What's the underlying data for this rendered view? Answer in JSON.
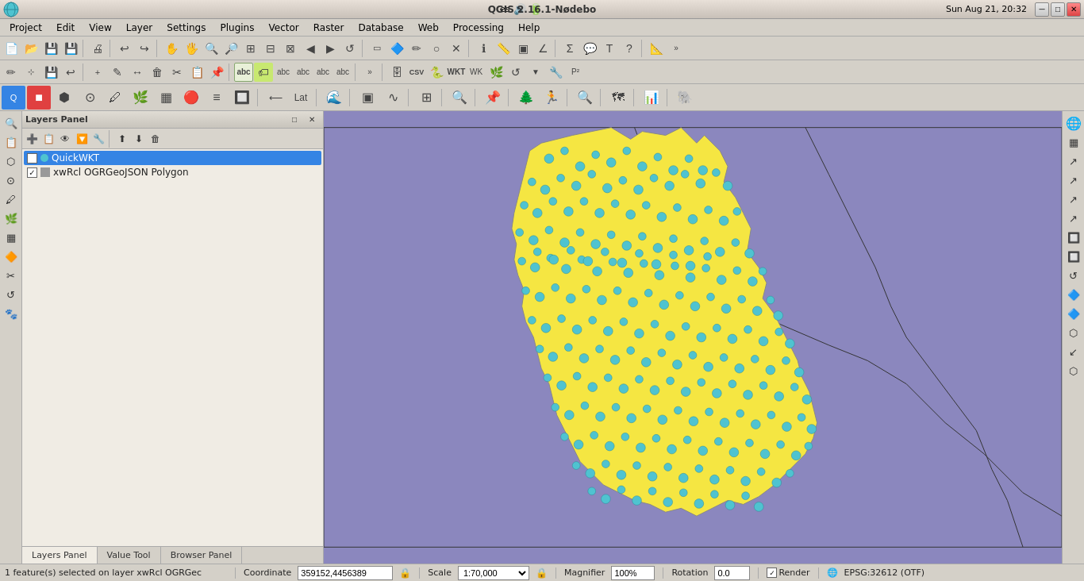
{
  "titlebar": {
    "app_icon": "🌍",
    "title": "QGIS 2.16.1-Nødebo",
    "sys_label": "es",
    "time": "Sun Aug 21, 20:32",
    "minimize": "─",
    "maximize": "□",
    "close": "✕"
  },
  "menubar": {
    "items": [
      "Project",
      "Edit",
      "View",
      "Layer",
      "Settings",
      "Plugins",
      "Vector",
      "Raster",
      "Database",
      "Web",
      "Processing",
      "Help"
    ]
  },
  "toolbar1": {
    "buttons": [
      "📄",
      "📂",
      "💾",
      "🖨",
      "🔄",
      "🔍",
      "🔎",
      "🔎",
      "🔎",
      "🔎",
      "🔎",
      "✋",
      "🖐",
      "↔",
      "🔄",
      "⬡",
      "⬡",
      "📌",
      "🔷",
      "🔲",
      "⬡",
      "🔍",
      "🔍",
      "🔍",
      "🔍",
      "🔍",
      "🔍",
      "🔄",
      "❓",
      "ℹ",
      "🔍",
      "⬡",
      "🔲",
      "🔲",
      "🔲",
      "🔲",
      "▶",
      "🔲",
      "🔲",
      "🔲",
      "⚙",
      "⚙",
      "⚙",
      "❓"
    ]
  },
  "layers_panel": {
    "title": "Layers Panel",
    "layers": [
      {
        "id": "quickwkt",
        "name": "QuickWKT",
        "visible": true,
        "selected": true,
        "color": "#4fc3d0"
      },
      {
        "id": "xwrcl",
        "name": "xwRcl OGRGeoJSON Polygon",
        "visible": true,
        "selected": false,
        "color": "#888888"
      }
    ],
    "toolbar_buttons": [
      "🔍",
      "📋",
      "👁",
      "🔽",
      "🔧",
      "⬆",
      "⬇",
      "🗑"
    ]
  },
  "panel_tabs": [
    {
      "id": "layers",
      "label": "Layers Panel",
      "active": true
    },
    {
      "id": "value",
      "label": "Value Tool",
      "active": false
    },
    {
      "id": "browser",
      "label": "Browser Panel",
      "active": false
    }
  ],
  "statusbar": {
    "message": "1 feature(s) selected on layer xwRcl OGRGec",
    "coord_label": "Coordinate",
    "coordinate": "359152,4456389",
    "scale_label": "Scale",
    "scale": "1:70,000",
    "mag_label": "Magnifier",
    "magnifier": "100%",
    "rotation_label": "Rotation",
    "rotation": "0.0",
    "render_label": "Render",
    "crs": "EPSG:32612 (OTF)"
  },
  "right_panel": {
    "buttons": [
      "🌐",
      "🗺",
      "⬡",
      "⬡",
      "⬡",
      "⬡",
      "🔲",
      "🔲",
      "↺",
      "🔷",
      "🔷",
      "⬡",
      "↙",
      "⬡"
    ]
  }
}
